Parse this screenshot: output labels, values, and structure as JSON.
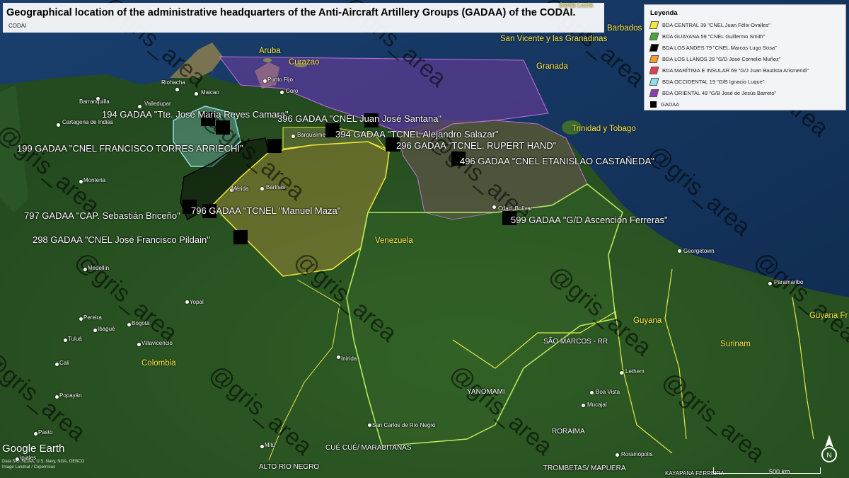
{
  "title": "Geographical location of the administrative headquarters of the Anti-Aircraft Artillery Groups (GADAA) of the CODAI.",
  "subtitle": "CODAI",
  "legend": {
    "title": "Leyenda",
    "items": [
      {
        "label": "BDA CENTRAL 39 \"CNEL Juan Félix Ovalles\"",
        "color": "#f2e83a"
      },
      {
        "label": "BDA GUAYANA 59 \"CNEL Guillermo Smith\"",
        "color": "#4aa63a"
      },
      {
        "label": "BDA LOS ANDES 79 \"CNEL Marcos Lugo Sosa\"",
        "color": "#000000"
      },
      {
        "label": "BDA LOS LLANOS 29 \"G/D José Cornelio Muñoz\"",
        "color": "#f0a030"
      },
      {
        "label": "BDA MARÍTIMA E INSULAR 69 \"G/J Juan Bautista Arismendi\"",
        "color": "#e04050"
      },
      {
        "label": "BDA OCCIDENTAL 19 \"G/B Ignacio Luque\"",
        "color": "#8fe0e8"
      },
      {
        "label": "BDA ORIENTAL 49 \"G/B José de Jesús Barreto\"",
        "color": "#8a3fb0"
      },
      {
        "label": "GADAA",
        "color": "#000000"
      }
    ]
  },
  "gadaa": [
    {
      "label": "194 GADAA \"Tte. José María Reyes Camara\""
    },
    {
      "label": "396 GADAA \"CNEL Juan José Santana\""
    },
    {
      "label": "394 GADAA \"TCNEL Alejandro Salazar\""
    },
    {
      "label": "296 GADAA \"TCNEL. RUPERT HAND\""
    },
    {
      "label": "199 GADAA \"CNEL FRANCISCO TORRES ARRIECHI\""
    },
    {
      "label": "496 GADAA \"CNEL ETANISLAO CASTAÑEDA\""
    },
    {
      "label": "797 GADAA \"CAP. Sebastián Briceño\""
    },
    {
      "label": "796 GADAA \"TCNEL \"Manuel Maza\""
    },
    {
      "label": "298 GADAA \"CNEL José Francisco Pildain\""
    },
    {
      "label": "599 GADAA \"G/D Ascención Ferreras\""
    }
  ],
  "countries": [
    "Aruba",
    "Curazao",
    "Venezuela",
    "Colombia",
    "Guyana",
    "Surinam",
    "Guyana Fr",
    "Trinidad y Tobago",
    "Granada",
    "Barbados",
    "San Vicente y las Granadinas",
    "Santa Lucía"
  ],
  "cities": [
    "Riohacha",
    "Maicao",
    "Barranquilla",
    "Valledupar",
    "Cartagena de Indias",
    "Punto Fijo",
    "Coro",
    "Barquisimeto",
    "Monteria",
    "Mérida",
    "Barinas",
    "Cdad. Bolívar",
    "Georgetown",
    "Paramaribo",
    "Medellín",
    "Yopal",
    "Pereira",
    "Ibagué",
    "Bogotá",
    "Tuluá",
    "Villavicencio",
    "Cali",
    "Inírida",
    "Popayán",
    "Pasto",
    "Ipiales",
    "Mitú",
    "San Carlos de Río Negro",
    "Lethem",
    "Boa Vista",
    "Mucajaí",
    "Rorainópolis"
  ],
  "regions": [
    "SÃO MARCOS - RR",
    "YANOMAMI",
    "RORAIMA",
    "CUÉ CUÉ/ MARABITANAS",
    "ALTO RIO NEGRO",
    "TROMBETAS/ MAPUERA",
    "KAYAPANA FERREIRA"
  ],
  "watermark": "@gris_area",
  "attribution": {
    "logo": "Google Earth",
    "credits": "Data SIO, NOAA, U.S. Navy, NGA, GEBCO",
    "credits2": "Image Landsat / Copernicus"
  },
  "scale_label": "500 km"
}
